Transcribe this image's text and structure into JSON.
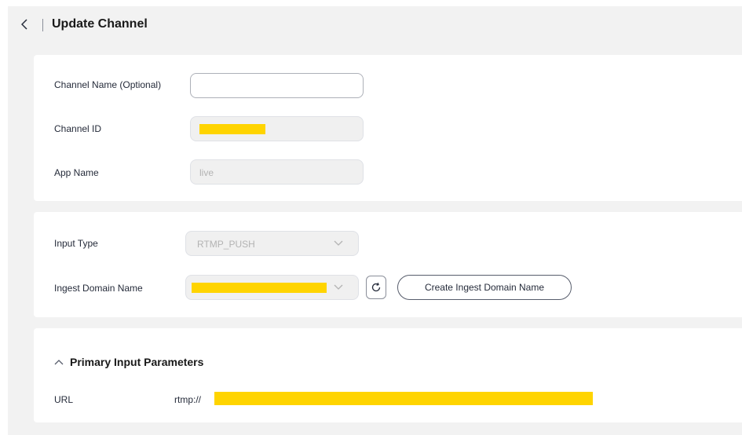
{
  "header": {
    "title": "Update Channel"
  },
  "basic": {
    "channel_name_label": "Channel Name (Optional)",
    "channel_name_value": "",
    "channel_id_label": "Channel ID",
    "app_name_label": "App Name",
    "app_name_value": "live"
  },
  "input": {
    "input_type_label": "Input Type",
    "input_type_value": "RTMP_PUSH",
    "ingest_domain_label": "Ingest Domain Name",
    "create_domain_button": "Create Ingest Domain Name"
  },
  "primary": {
    "section_title": "Primary Input Parameters",
    "url_label": "URL",
    "url_prefix": "rtmp://"
  },
  "icons": {
    "back": "chevron-left-icon",
    "select_arrow": "chevron-down-icon",
    "refresh": "refresh-icon",
    "collapse": "chevron-up-icon"
  },
  "colors": {
    "page_bg": "#f2f2f2",
    "card_bg": "#ffffff",
    "redaction": "#ffd400",
    "border": "#adb0b8"
  }
}
